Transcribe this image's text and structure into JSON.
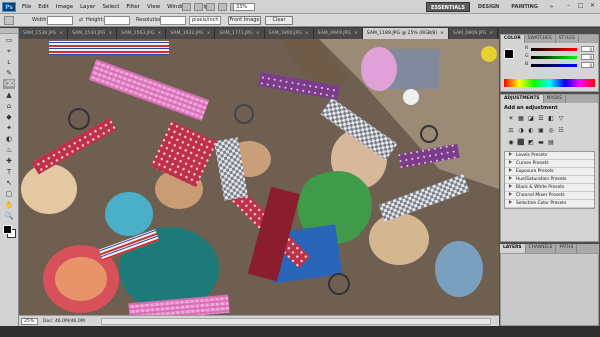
{
  "app": {
    "logo": "Ps"
  },
  "menubar": {
    "items": [
      "File",
      "Edit",
      "Image",
      "Layer",
      "Select",
      "Filter",
      "View",
      "Window",
      "Help"
    ],
    "zoom_value": "33%",
    "workspaces": [
      "ESSENTIALS",
      "DESIGN",
      "PAINTING"
    ],
    "workspace_more": "»",
    "window_controls": [
      "–",
      "□",
      "✕"
    ]
  },
  "options": {
    "width_label": "Width:",
    "height_label": "Height:",
    "resolution_label": "Resolution:",
    "resolution_unit": "pixels/inch",
    "front_image_button": "Front Image",
    "clear_button": "Clear"
  },
  "tabs": [
    {
      "label": "SAM_1539.JPG",
      "active": false
    },
    {
      "label": "SAM_1544.JPG",
      "active": false
    },
    {
      "label": "SAM_1563.JPG",
      "active": false
    },
    {
      "label": "SAM_1622.JPG",
      "active": false
    },
    {
      "label": "SAM_1771.JPG",
      "active": false
    },
    {
      "label": "SAM_1800.JPG",
      "active": false
    },
    {
      "label": "SAM_0949.JPG",
      "active": false
    },
    {
      "label": "SAM_1189.JPG @ 25% (RGB/8)",
      "active": true
    },
    {
      "label": "SAM_0809.JPG",
      "active": false
    }
  ],
  "status": {
    "zoom": "25%",
    "doc": "Doc: 46.0M/46.0M"
  },
  "color_panel": {
    "tabs": [
      "COLOR",
      "SWATCHES",
      "STYLES"
    ],
    "channels": [
      {
        "name": "R",
        "value": "0"
      },
      {
        "name": "G",
        "value": "0"
      },
      {
        "name": "B",
        "value": "0"
      }
    ]
  },
  "adjustments_panel": {
    "tabs": [
      "ADJUSTMENTS",
      "MASKS"
    ],
    "title": "Add an adjustment",
    "icons_row1": [
      "☀",
      "▦",
      "◪",
      "☰",
      "◧",
      "▽"
    ],
    "icons_row2": [
      "⚖",
      "◑",
      "◐",
      "▣",
      "◎",
      "☷"
    ],
    "icons_row3": [
      "◉",
      "⬛",
      "◩",
      "▬",
      "▤"
    ],
    "presets": [
      "Levels Presets",
      "Curves Presets",
      "Exposure Presets",
      "Hue/Saturation Presets",
      "Black & White Presets",
      "Channel Mixer Presets",
      "Selective Color Presets"
    ]
  },
  "layers_panel": {
    "tabs": [
      "LAYERS",
      "CHANNELS",
      "PATHS"
    ]
  },
  "tools": [
    "▭",
    "⌖",
    "ʟ",
    "✎",
    "⌫",
    "▲",
    "⌂",
    "◆",
    "✦",
    "◐",
    "♨",
    "✚",
    "T",
    "↖",
    "▢",
    "✋",
    "🔍"
  ]
}
